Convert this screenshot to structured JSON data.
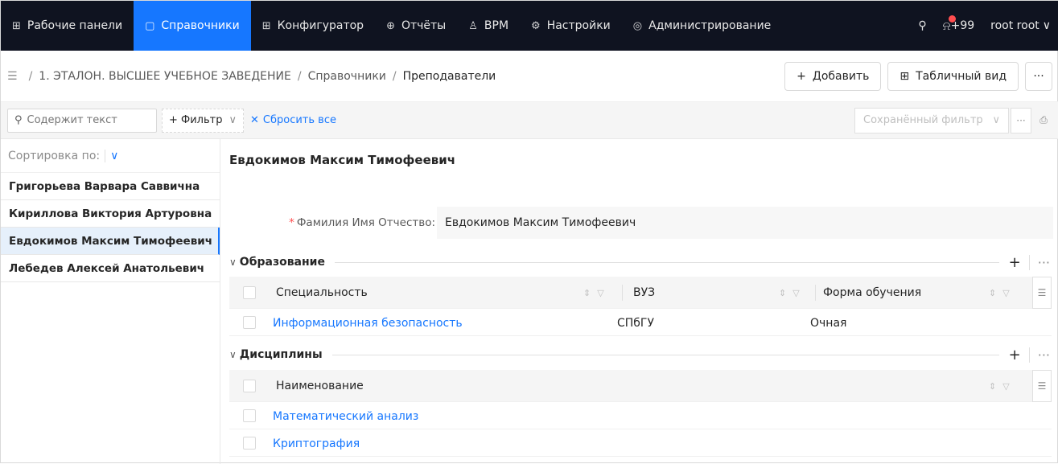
{
  "nav": {
    "items": [
      {
        "icon": "grid-icon",
        "glyph": "⊞",
        "label": "Рабочие панели",
        "active": false
      },
      {
        "icon": "book-icon",
        "glyph": "▢",
        "label": "Справочники",
        "active": true
      },
      {
        "icon": "grid-icon",
        "glyph": "⊞",
        "label": "Конфигуратор",
        "active": false
      },
      {
        "icon": "reports-icon",
        "glyph": "⊕",
        "label": "Отчёты",
        "active": false
      },
      {
        "icon": "bpm-icon",
        "glyph": "♙",
        "label": "BPM",
        "active": false
      },
      {
        "icon": "gear-icon",
        "glyph": "⚙",
        "label": "Настройки",
        "active": false
      },
      {
        "icon": "shield-icon",
        "glyph": "◎",
        "label": "Администрирование",
        "active": false
      }
    ],
    "notifications": "+99",
    "user": "root root"
  },
  "breadcrumb": {
    "items": [
      "1. ЭТАЛОН. ВЫСШЕЕ УЧЕБНОЕ ЗАВЕДЕНИЕ",
      "Справочники",
      "Преподаватели"
    ]
  },
  "toolbar": {
    "add_label": "Добавить",
    "table_view_label": "Табличный вид"
  },
  "filter": {
    "search_placeholder": "Содержит текст",
    "filter_label": "+ Фильтр",
    "reset_label": "Сбросить все",
    "saved_filter_placeholder": "Сохранённый фильтр"
  },
  "list": {
    "sort_label": "Сортировка по:",
    "items": [
      {
        "name": "Григорьева Варвара Саввична",
        "selected": false
      },
      {
        "name": "Кириллова Виктория Артуровна",
        "selected": false
      },
      {
        "name": "Евдокимов Максим Тимофеевич",
        "selected": true
      },
      {
        "name": "Лебедев Алексей Анатольевич",
        "selected": false
      }
    ]
  },
  "detail": {
    "title": "Евдокимов Максим Тимофеевич",
    "fio_label": "Фамилия Имя Отчество:",
    "fio_value": "Евдокимов Максим Тимофеевич",
    "education": {
      "title": "Образование",
      "columns": [
        "Специальность",
        "ВУЗ",
        "Форма обучения"
      ],
      "rows": [
        {
          "specialty": "Информационная безопасность",
          "university": "СПбГУ",
          "form": "Очная"
        }
      ]
    },
    "disciplines": {
      "title": "Дисциплины",
      "columns": [
        "Наименование"
      ],
      "rows": [
        "Математический анализ",
        "Криптография"
      ]
    }
  },
  "colors": {
    "accent": "#1677ff",
    "nav_bg": "#0f1320",
    "required": "#ff4d4f"
  }
}
